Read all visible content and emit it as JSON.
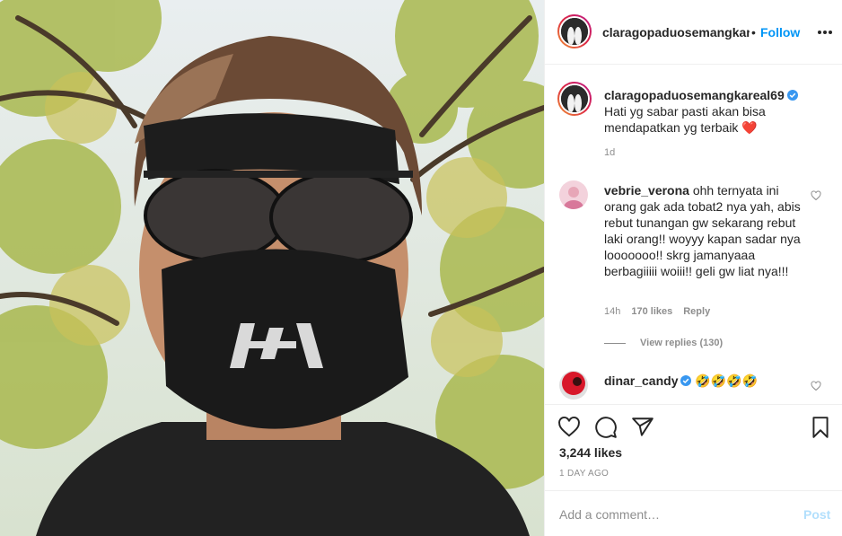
{
  "post": {
    "username": "claragopaduosemangkareal69",
    "header_dot": "•",
    "follow_label": "Follow",
    "caption_text": "Hati yg sabar pasti akan bisa mendapatkan yg terbaik ❤️",
    "caption_time": "1d",
    "likes": "3,244 likes",
    "date": "1 DAY AGO"
  },
  "comments": [
    {
      "username": "vebrie_verona",
      "text": "ohh ternyata ini orang gak ada tobat2 nya yah, abis rebut tunangan gw sekarang rebut laki orang!! woyyy kapan sadar nya looooooo!! skrg jamanyaaa berbagiiiii woiii!! geli gw liat nya!!!",
      "time": "14h",
      "likes": "170 likes",
      "reply_label": "Reply",
      "view_replies": "View replies (130)"
    },
    {
      "username": "dinar_candy",
      "text": "🤣🤣🤣🤣"
    }
  ],
  "add_comment": {
    "placeholder": "Add a comment…",
    "post_label": "Post"
  },
  "icons": {
    "more": "more-horizontal-icon",
    "like": "heart-icon",
    "comment": "comment-icon",
    "share": "paper-plane-icon",
    "save": "bookmark-icon",
    "verified": "verified-badge-icon"
  },
  "colors": {
    "link_blue": "#0095f6",
    "verified_blue": "#3897f0",
    "muted_gray": "#8e8e8e",
    "post_disabled": "#b2dffc",
    "heart_red": "#ed4956"
  }
}
